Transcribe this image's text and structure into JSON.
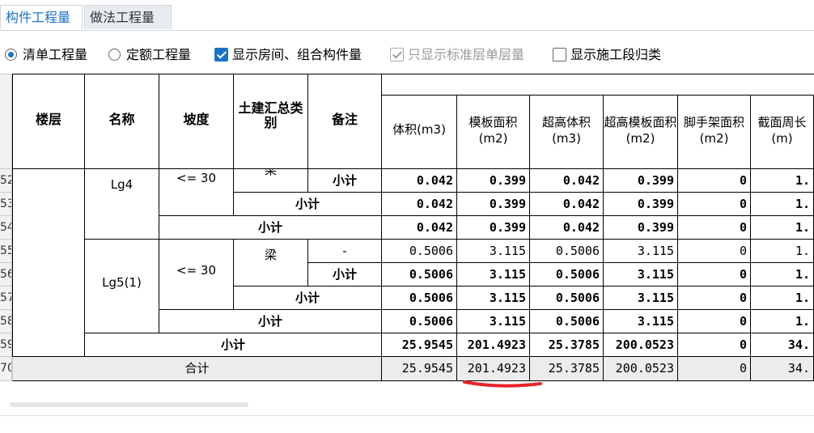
{
  "tabs": [
    {
      "label": "构件工程量",
      "active": true
    },
    {
      "label": "做法工程量",
      "active": false
    }
  ],
  "options": {
    "radio1": "清单工程量",
    "radio2": "定额工程量",
    "check1": "显示房间、组合构件量",
    "check2": "只显示标准层单层量",
    "check3": "显示施工段归类"
  },
  "headers": {
    "floor": "楼层",
    "name": "名称",
    "slope": "坡度",
    "category": "土建汇总类别",
    "remark": "备注",
    "volume": "体积(m3)",
    "formwork_area": "模板面积(m2)",
    "over_volume": "超高体积(m3)",
    "over_formwork": "超高模板面积(m2)",
    "scaffold": "脚手架面积(m2)",
    "perimeter": "截面周长(m)"
  },
  "rows": [
    {
      "num": "52",
      "name": "Lg4",
      "slope": "<= 30",
      "category": "梁",
      "remark": "小计",
      "volume": "0.042",
      "formwork": "0.399",
      "over_volume": "0.042",
      "over_formwork": "0.399",
      "scaffold": "0",
      "perimeter": "1."
    },
    {
      "num": "53",
      "subtotal": "小计",
      "volume": "0.042",
      "formwork": "0.399",
      "over_volume": "0.042",
      "over_formwork": "0.399",
      "scaffold": "0",
      "perimeter": "1."
    },
    {
      "num": "54",
      "subtotal": "小计",
      "volume": "0.042",
      "formwork": "0.399",
      "over_volume": "0.042",
      "over_formwork": "0.399",
      "scaffold": "0",
      "perimeter": "1."
    },
    {
      "num": "55",
      "name": "Lg5(1)",
      "slope": "<= 30",
      "category": "梁",
      "remark": "-",
      "volume": "0.5006",
      "formwork": "3.115",
      "over_volume": "0.5006",
      "over_formwork": "3.115",
      "scaffold": "0",
      "perimeter": "1."
    },
    {
      "num": "56",
      "remark": "小计",
      "volume": "0.5006",
      "formwork": "3.115",
      "over_volume": "0.5006",
      "over_formwork": "3.115",
      "scaffold": "0",
      "perimeter": "1."
    },
    {
      "num": "57",
      "subtotal": "小计",
      "volume": "0.5006",
      "formwork": "3.115",
      "over_volume": "0.5006",
      "over_formwork": "3.115",
      "scaffold": "0",
      "perimeter": "1."
    },
    {
      "num": "58",
      "subtotal": "小计",
      "volume": "0.5006",
      "formwork": "3.115",
      "over_volume": "0.5006",
      "over_formwork": "3.115",
      "scaffold": "0",
      "perimeter": "1."
    },
    {
      "num": "59",
      "subtotal": "小计",
      "volume": "25.9545",
      "formwork": "201.4923",
      "over_volume": "25.3785",
      "over_formwork": "200.0523",
      "scaffold": "0",
      "perimeter": "34."
    },
    {
      "num": "70",
      "total": "合计",
      "volume": "25.9545",
      "formwork": "201.4923",
      "over_volume": "25.3785",
      "over_formwork": "200.0523",
      "scaffold": "0",
      "perimeter": "34."
    }
  ]
}
